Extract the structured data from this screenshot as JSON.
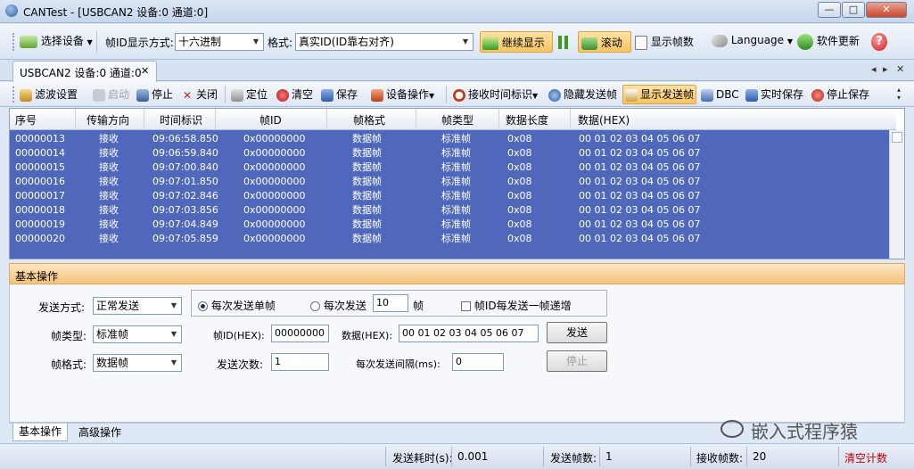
{
  "window": {
    "title": "CANTest  - [USBCAN2 设备:0 通道:0]",
    "controls": {
      "minimize": "—",
      "maximize": "□",
      "close": "✕"
    }
  },
  "toolbar1": {
    "select_device": "选择设备",
    "frame_id_format_label": "帧ID显示方式:",
    "frame_id_format_value": "十六进制",
    "format_label": "格式:",
    "format_value": "真实ID(ID靠右对齐)",
    "continue_display": "继续显示",
    "scroll": "滚动",
    "show_frames": "显示帧数",
    "language": "Language",
    "software_update": "软件更新"
  },
  "doc_tab": {
    "label": "USBCAN2 设备:0 通道:0",
    "close": "✕"
  },
  "tab_nav": {
    "prev": "◂",
    "next": "▸",
    "close": "✕"
  },
  "toolbar2": {
    "filter_settings": "滤波设置",
    "start": "启动",
    "stop": "停止",
    "close": "关闭",
    "locate": "定位",
    "clear": "清空",
    "save": "保存",
    "device_ops": "设备操作",
    "rx_time_mark": "接收时间标识",
    "hide_sent_frames": "隐藏发送帧",
    "show_sent_frames": "显示发送帧",
    "dbc": "DBC",
    "realtime_save": "实时保存",
    "stop_save": "停止保存"
  },
  "grid": {
    "headers": [
      "序号",
      "传输方向",
      "时间标识",
      "帧ID",
      "帧格式",
      "帧类型",
      "数据长度",
      "数据(HEX)"
    ],
    "rows": [
      [
        "00000013",
        "接收",
        "09:06:58.850",
        "0x00000000",
        "数据帧",
        "标准帧",
        "0x08",
        "00 01 02 03 04 05 06 07"
      ],
      [
        "00000014",
        "接收",
        "09:06:59.840",
        "0x00000000",
        "数据帧",
        "标准帧",
        "0x08",
        "00 01 02 03 04 05 06 07"
      ],
      [
        "00000015",
        "接收",
        "09:07:00.840",
        "0x00000000",
        "数据帧",
        "标准帧",
        "0x08",
        "00 01 02 03 04 05 06 07"
      ],
      [
        "00000016",
        "接收",
        "09:07:01.850",
        "0x00000000",
        "数据帧",
        "标准帧",
        "0x08",
        "00 01 02 03 04 05 06 07"
      ],
      [
        "00000017",
        "接收",
        "09:07:02.846",
        "0x00000000",
        "数据帧",
        "标准帧",
        "0x08",
        "00 01 02 03 04 05 06 07"
      ],
      [
        "00000018",
        "接收",
        "09:07:03.856",
        "0x00000000",
        "数据帧",
        "标准帧",
        "0x08",
        "00 01 02 03 04 05 06 07"
      ],
      [
        "00000019",
        "接收",
        "09:07:04.849",
        "0x00000000",
        "数据帧",
        "标准帧",
        "0x08",
        "00 01 02 03 04 05 06 07"
      ],
      [
        "00000020",
        "接收",
        "09:07:05.859",
        "0x00000000",
        "数据帧",
        "标准帧",
        "0x08",
        "00 01 02 03 04 05 06 07"
      ]
    ]
  },
  "panel": {
    "title": "基本操作",
    "send_mode_label": "发送方式:",
    "send_mode_value": "正常发送",
    "radio_single": "每次发送单帧",
    "radio_multi": "每次发送",
    "multi_count": "10",
    "multi_unit": "帧",
    "increment_id": "帧ID每发送一帧递增",
    "frame_type_label": "帧类型:",
    "frame_type_value": "标准帧",
    "frame_id_label": "帧ID(HEX):",
    "frame_id_value": "00000000",
    "data_label": "数据(HEX):",
    "data_value": "00 01 02 03 04 05 06 07",
    "send_button": "发送",
    "frame_format_label": "帧格式:",
    "frame_format_value": "数据帧",
    "send_count_label": "发送次数:",
    "send_count_value": "1",
    "interval_label": "每次发送间隔(ms):",
    "interval_value": "0",
    "stop_button": "停止"
  },
  "bottom_tabs": [
    "基本操作",
    "高级操作"
  ],
  "watermark": "嵌入式程序猿",
  "status": {
    "send_time_label": "发送耗时(s):",
    "send_time_value": "0.001",
    "send_frames_label": "发送帧数:",
    "send_frames_value": "1",
    "recv_frames_label": "接收帧数:",
    "recv_frames_value": "20",
    "clear_count": "清空计数"
  },
  "colors": {
    "selection": "#4f68bb",
    "highlight": "#f7c460",
    "panel_header": "#f5c27a",
    "clear_count": "#c00000"
  }
}
